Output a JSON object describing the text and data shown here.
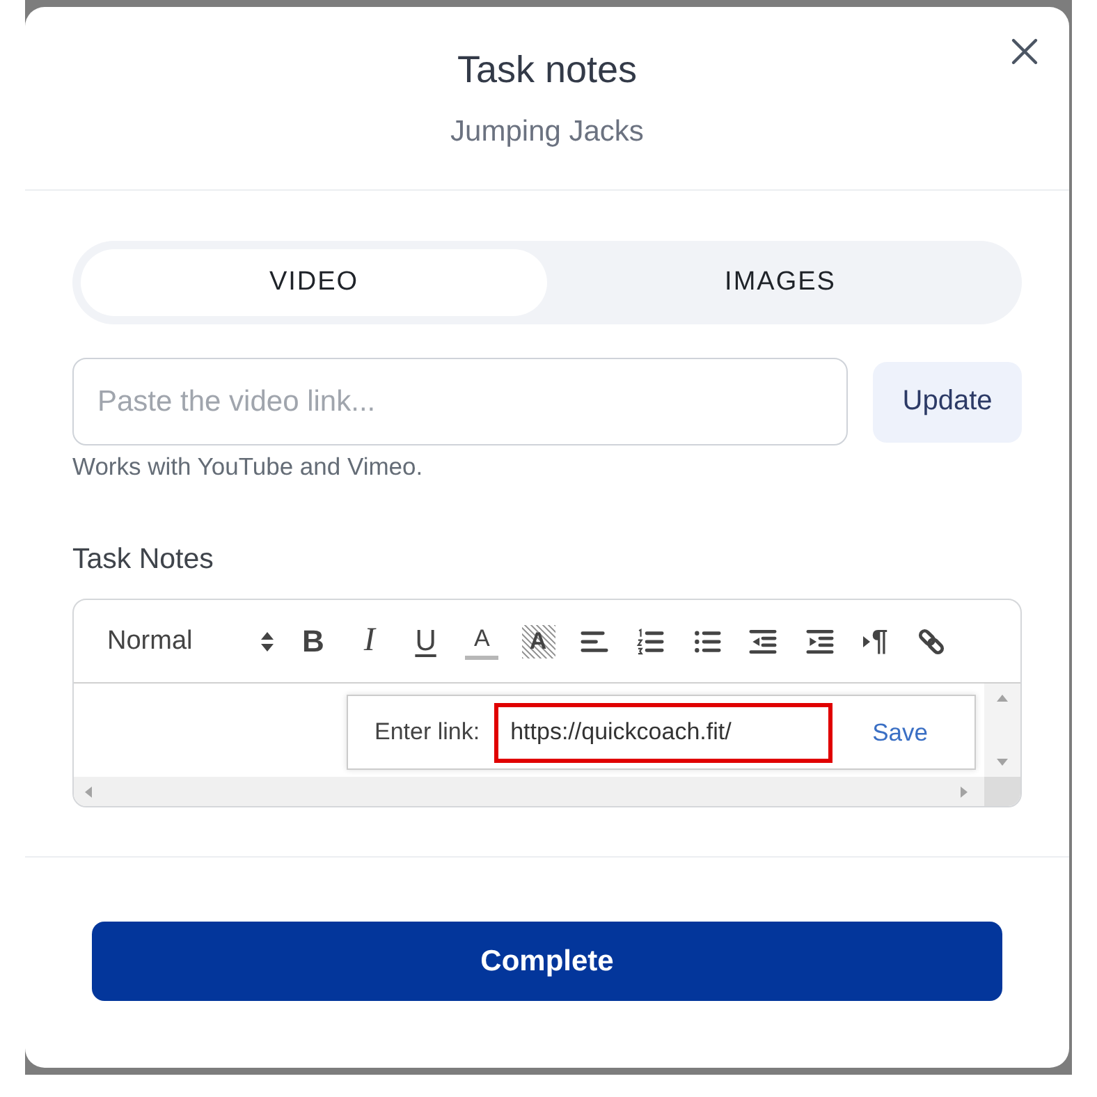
{
  "dialog": {
    "title": "Task notes",
    "subtitle": "Jumping Jacks"
  },
  "tabs": [
    {
      "label": "VIDEO",
      "selected": true
    },
    {
      "label": "IMAGES",
      "selected": false
    }
  ],
  "video_link": {
    "placeholder": "Paste the video link...",
    "button": "Update",
    "hint": "Works with YouTube and Vimeo."
  },
  "notes": {
    "label": "Task Notes",
    "format_picker": "Normal",
    "toolbar": [
      {
        "kind": "bold",
        "glyph": "B"
      },
      {
        "kind": "italic",
        "glyph": "I"
      },
      {
        "kind": "underline",
        "glyph": "U"
      },
      {
        "kind": "color",
        "glyph": "A"
      },
      {
        "kind": "background",
        "glyph": "A"
      },
      {
        "kind": "align"
      },
      {
        "kind": "ordered-list"
      },
      {
        "kind": "bullet-list"
      },
      {
        "kind": "outdent"
      },
      {
        "kind": "indent"
      },
      {
        "kind": "direction",
        "glyph": "¶"
      },
      {
        "kind": "link"
      }
    ],
    "link_tooltip": {
      "label": "Enter link:",
      "value": "https://quickcoach.fit/",
      "highlighted": true,
      "action": "Save"
    }
  },
  "footer": {
    "button": "Complete"
  }
}
